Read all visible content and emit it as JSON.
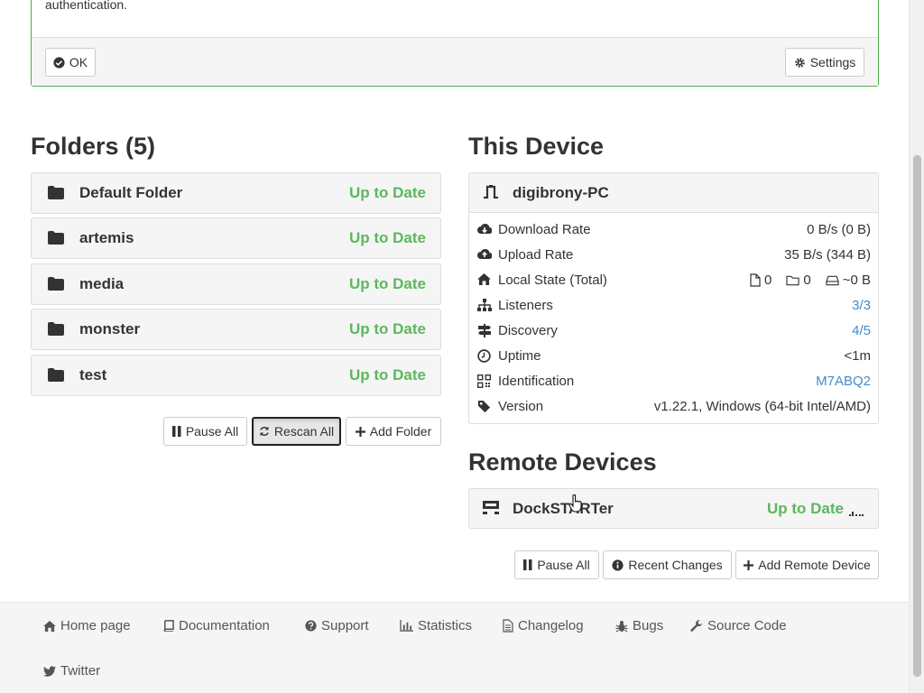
{
  "notice": {
    "text_fragment": "authentication.",
    "ok_label": "OK",
    "settings_label": "Settings"
  },
  "folders": {
    "title": "Folders (5)",
    "items": [
      {
        "name": "Default Folder",
        "status": "Up to Date"
      },
      {
        "name": "artemis",
        "status": "Up to Date"
      },
      {
        "name": "media",
        "status": "Up to Date"
      },
      {
        "name": "monster",
        "status": "Up to Date"
      },
      {
        "name": "test",
        "status": "Up to Date"
      }
    ],
    "pause_all": "Pause All",
    "rescan_all": "Rescan All",
    "add_folder": "Add Folder"
  },
  "this_device": {
    "title": "This Device",
    "name": "digibrony-PC",
    "rows": [
      {
        "icon": "cloud-download-icon",
        "label": "Download Rate",
        "value": "0 B/s (0 B)"
      },
      {
        "icon": "cloud-upload-icon",
        "label": "Upload Rate",
        "value": "35 B/s (344 B)"
      },
      {
        "icon": "home-icon",
        "label": "Local State (Total)",
        "files": "0",
        "dirs": "0",
        "size": "~0 B"
      },
      {
        "icon": "sitemap-icon",
        "label": "Listeners",
        "value": "3/3"
      },
      {
        "icon": "signpost-icon",
        "label": "Discovery",
        "value": "4/5"
      },
      {
        "icon": "clock-icon",
        "label": "Uptime",
        "value": "<1m"
      },
      {
        "icon": "qrcode-icon",
        "label": "Identification",
        "value": "M7ABQ2"
      },
      {
        "icon": "tag-icon",
        "label": "Version",
        "value": "v1.22.1, Windows (64-bit Intel/AMD)"
      }
    ]
  },
  "remote_devices": {
    "title": "Remote Devices",
    "items": [
      {
        "name": "DockSTARTer",
        "status": "Up to Date"
      }
    ],
    "pause_all": "Pause All",
    "recent_changes": "Recent Changes",
    "add_remote": "Add Remote Device"
  },
  "footer": {
    "links": [
      "Home page",
      "Documentation",
      "Support",
      "Statistics",
      "Changelog",
      "Bugs",
      "Source Code",
      "Twitter"
    ]
  },
  "colors": {
    "success": "#5cb85c",
    "link": "#428bca",
    "panel_border_success": "#4cae4c"
  }
}
